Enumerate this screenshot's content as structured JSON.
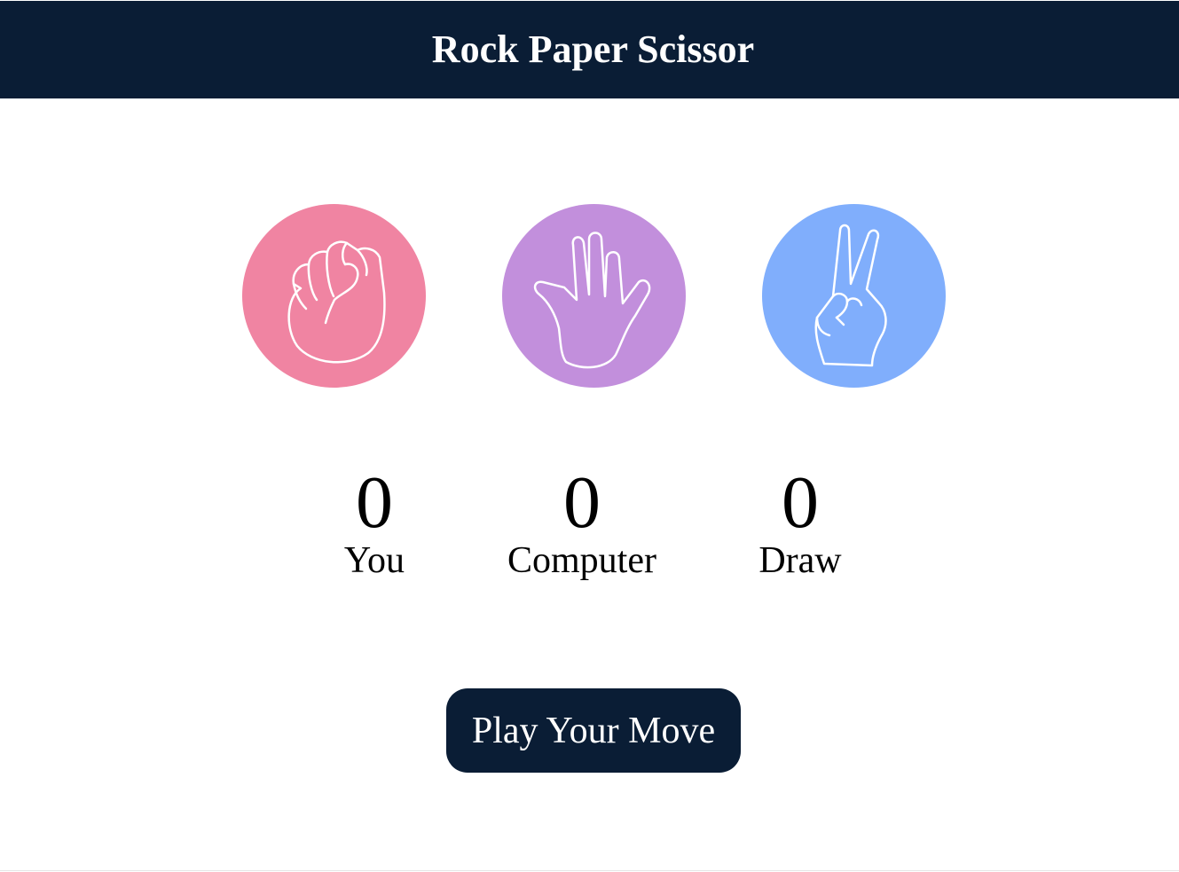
{
  "header": {
    "title": "Rock Paper Scissor"
  },
  "choices": [
    {
      "name": "rock",
      "icon": "fist-icon",
      "color": "#f084a2"
    },
    {
      "name": "paper",
      "icon": "open-hand-icon",
      "color": "#c28fdc"
    },
    {
      "name": "scissor",
      "icon": "peace-hand-icon",
      "color": "#80aefc"
    }
  ],
  "scores": {
    "you": {
      "value": "0",
      "label": "You"
    },
    "computer": {
      "value": "0",
      "label": "Computer"
    },
    "draw": {
      "value": "0",
      "label": "Draw"
    }
  },
  "play_button": {
    "label": "Play Your Move"
  },
  "colors": {
    "header_bg": "#0a1d35",
    "button_bg": "#0a1d35"
  }
}
